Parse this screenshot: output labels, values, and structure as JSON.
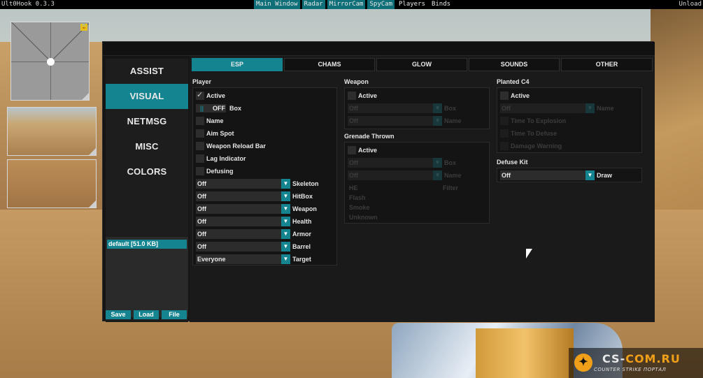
{
  "menubar": {
    "app_title": "Ult0Hook 0.3.3",
    "unload": "Unload",
    "items": [
      {
        "label": "Main Window",
        "active": true
      },
      {
        "label": "Radar",
        "active": true
      },
      {
        "label": "MirrorCam",
        "active": true
      },
      {
        "label": "SpyCam",
        "active": true
      },
      {
        "label": "Players",
        "active": false
      },
      {
        "label": "Binds",
        "active": false
      }
    ]
  },
  "colors": {
    "accent": "#148590",
    "panel": "#1a1a1a",
    "text": "#e6e6e6"
  },
  "sidebar": {
    "items": [
      {
        "label": "ASSIST",
        "active": false
      },
      {
        "label": "VISUAL",
        "active": true
      },
      {
        "label": "NETMSG",
        "active": false
      },
      {
        "label": "MISC",
        "active": false
      },
      {
        "label": "COLORS",
        "active": false
      }
    ],
    "config_item": "default [51.0 KB]",
    "buttons": {
      "save": "Save",
      "load": "Load",
      "file": "File"
    }
  },
  "tabs": [
    {
      "label": "ESP",
      "active": true
    },
    {
      "label": "CHAMS",
      "active": false
    },
    {
      "label": "GLOW",
      "active": false
    },
    {
      "label": "SOUNDS",
      "active": false
    },
    {
      "label": "OTHER",
      "active": false
    }
  ],
  "player": {
    "title": "Player",
    "active": "Active",
    "box_toggle": "OFF",
    "box_toggle_knob": "||",
    "box": "Box",
    "name": "Name",
    "aim_spot": "Aim Spot",
    "weapon_reload_bar": "Weapon Reload Bar",
    "lag_indicator": "Lag Indicator",
    "defusing": "Defusing",
    "selects": [
      {
        "value": "Off",
        "label": "Skeleton"
      },
      {
        "value": "Off",
        "label": "HitBox"
      },
      {
        "value": "Off",
        "label": "Weapon"
      },
      {
        "value": "Off",
        "label": "Health"
      },
      {
        "value": "Off",
        "label": "Armor"
      },
      {
        "value": "Off",
        "label": "Barrel"
      },
      {
        "value": "Everyone",
        "label": "Target"
      }
    ]
  },
  "weapon": {
    "title": "Weapon",
    "active": "Active",
    "selects": [
      {
        "value": "Off",
        "label": "Box"
      },
      {
        "value": "Off",
        "label": "Name"
      }
    ]
  },
  "grenade": {
    "title": "Grenade Thrown",
    "active": "Active",
    "selects": [
      {
        "value": "Off",
        "label": "Box"
      },
      {
        "value": "Off",
        "label": "Name"
      }
    ],
    "filter_label": "Filter",
    "filters": [
      "HE",
      "Flash",
      "Smoke",
      "Unknown"
    ]
  },
  "c4": {
    "title": "Planted C4",
    "active": "Active",
    "select": {
      "value": "Off",
      "label": "Name"
    },
    "options": [
      "Time To Explosion",
      "Time To Defuse",
      "Damage Warning"
    ]
  },
  "defuse_kit": {
    "title": "Defuse Kit",
    "select": {
      "value": "Off",
      "label": "Draw"
    }
  },
  "watermark": {
    "site_a": "CS-",
    "site_b": "COM.RU",
    "subtitle": "COUNTER STRIKE ПОРТАЛ"
  }
}
